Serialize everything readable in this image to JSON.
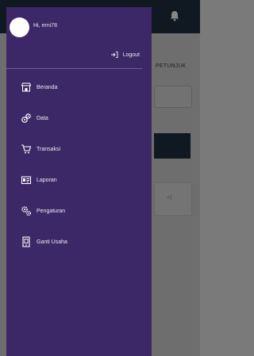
{
  "background_app": {
    "petunjuk_label": "PETUNJUK",
    "button_label": "»|"
  },
  "drawer": {
    "greeting": "Hi, erni78",
    "logout_label": "Logout",
    "menu": [
      {
        "label": "Beranda",
        "icon": "store-icon"
      },
      {
        "label": "Data",
        "icon": "data-icon"
      },
      {
        "label": "Transaksi",
        "icon": "cart-icon"
      },
      {
        "label": "Laporan",
        "icon": "report-icon"
      },
      {
        "label": "Pengaturan",
        "icon": "settings-icon"
      },
      {
        "label": "Ganti Usaha",
        "icon": "switch-business-icon"
      }
    ]
  },
  "colors": {
    "drawer_bg": "#3c2867",
    "topbar_bg": "#1c2a3c"
  }
}
